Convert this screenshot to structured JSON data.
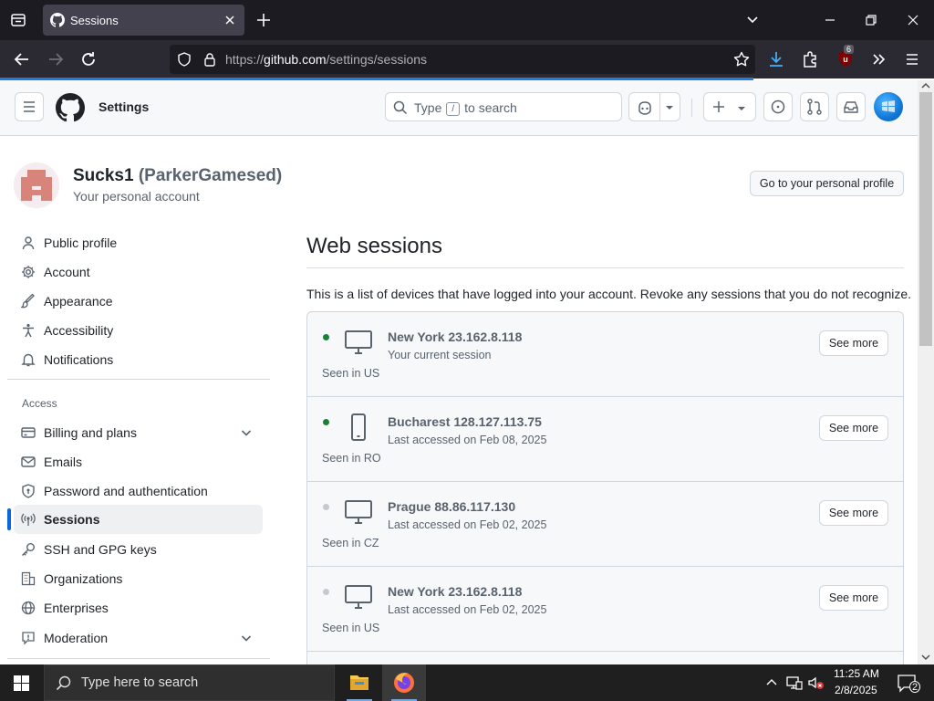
{
  "browser": {
    "tab_title": "Sessions",
    "url_prefix": "https://",
    "url_domain": "github.com",
    "url_path": "/settings/sessions",
    "extension_badge": "6"
  },
  "header": {
    "title": "Settings",
    "search_before": "Type",
    "search_key": "/",
    "search_after": "to search"
  },
  "account": {
    "name": "Sucks1",
    "handle": "(ParkerGamesed)",
    "subtitle": "Your personal account",
    "profile_button": "Go to your personal profile"
  },
  "sidebar": {
    "items": [
      {
        "label": "Public profile",
        "icon": "person-icon"
      },
      {
        "label": "Account",
        "icon": "gear-icon"
      },
      {
        "label": "Appearance",
        "icon": "paintbrush-icon"
      },
      {
        "label": "Accessibility",
        "icon": "accessibility-icon"
      },
      {
        "label": "Notifications",
        "icon": "bell-icon"
      }
    ],
    "section_label": "Access",
    "access_items": [
      {
        "label": "Billing and plans",
        "icon": "credit-card-icon"
      },
      {
        "label": "Emails",
        "icon": "mail-icon"
      },
      {
        "label": "Password and authentication",
        "icon": "shield-lock-icon"
      },
      {
        "label": "Sessions",
        "icon": "broadcast-icon"
      },
      {
        "label": "SSH and GPG keys",
        "icon": "key-icon"
      },
      {
        "label": "Organizations",
        "icon": "organization-icon"
      },
      {
        "label": "Enterprises",
        "icon": "globe-icon"
      },
      {
        "label": "Moderation",
        "icon": "report-icon"
      }
    ]
  },
  "main": {
    "title": "Web sessions",
    "description": "This is a list of devices that have logged into your account. Revoke any sessions that you do not recognize.",
    "sessions": [
      {
        "title": "New York 23.162.8.118",
        "subtitle": "Your current session",
        "seen": "Seen in US",
        "device": "desktop-icon",
        "status": "active",
        "button": "See more"
      },
      {
        "title": "Bucharest 128.127.113.75",
        "subtitle": "Last accessed on Feb 08, 2025",
        "seen": "Seen in RO",
        "device": "mobile-icon",
        "status": "active",
        "button": "See more"
      },
      {
        "title": "Prague 88.86.117.130",
        "subtitle": "Last accessed on Feb 02, 2025",
        "seen": "Seen in CZ",
        "device": "desktop-icon",
        "status": "inactive",
        "button": "See more"
      },
      {
        "title": "New York 23.162.8.118",
        "subtitle": "Last accessed on Feb 02, 2025",
        "seen": "Seen in US",
        "device": "desktop-icon",
        "status": "inactive",
        "button": "See more"
      }
    ]
  },
  "taskbar": {
    "search_placeholder": "Type here to search",
    "time": "11:25 AM",
    "date": "2/8/2025",
    "notification_count": "2"
  },
  "colors": {
    "active_dot": "#1a7f37",
    "inactive_dot": "#afb8c1",
    "accent": "#0969da"
  }
}
